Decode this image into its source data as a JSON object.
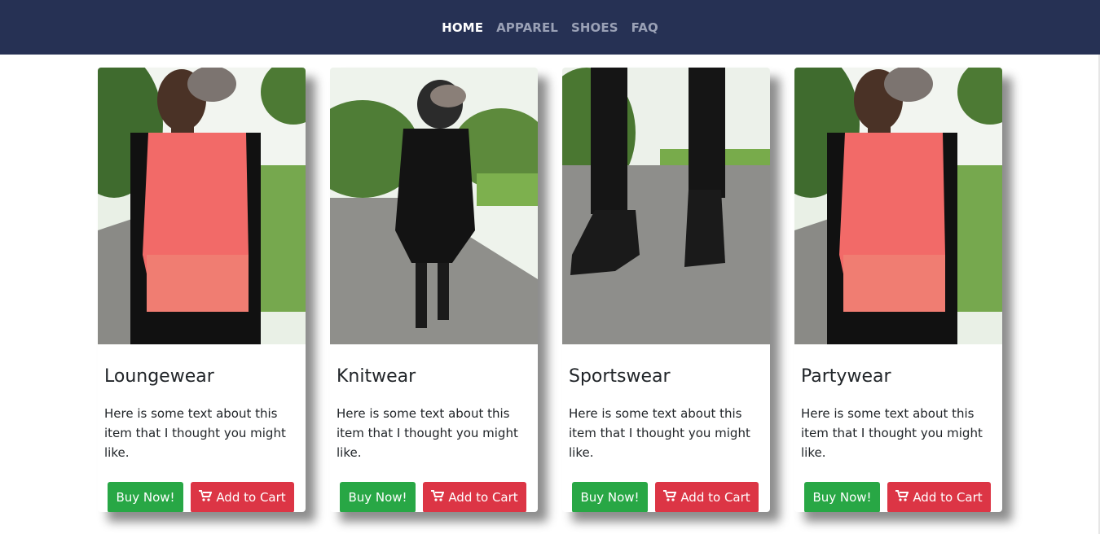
{
  "nav": {
    "items": [
      {
        "label": "HOME",
        "active": true
      },
      {
        "label": "APPAREL",
        "active": false
      },
      {
        "label": "SHOES",
        "active": false
      },
      {
        "label": "FAQ",
        "active": false
      }
    ]
  },
  "cards": [
    {
      "title": "Loungewear",
      "text": "Here is some text about this item that I thought you might like.",
      "buy_label": "Buy Now!",
      "cart_label": "Add to Cart"
    },
    {
      "title": "Knitwear",
      "text": "Here is some text about this item that I thought you might like.",
      "buy_label": "Buy Now!",
      "cart_label": "Add to Cart"
    },
    {
      "title": "Sportswear",
      "text": "Here is some text about this item that I thought you might like.",
      "buy_label": "Buy Now!",
      "cart_label": "Add to Cart"
    },
    {
      "title": "Partywear",
      "text": "Here is some text about this item that I thought you might like.",
      "buy_label": "Buy Now!",
      "cart_label": "Add to Cart"
    }
  ],
  "colors": {
    "navbar": "#263154",
    "buy": "#28a745",
    "cart": "#dc3545"
  },
  "icons": {
    "cart": "shopping-cart-icon"
  }
}
